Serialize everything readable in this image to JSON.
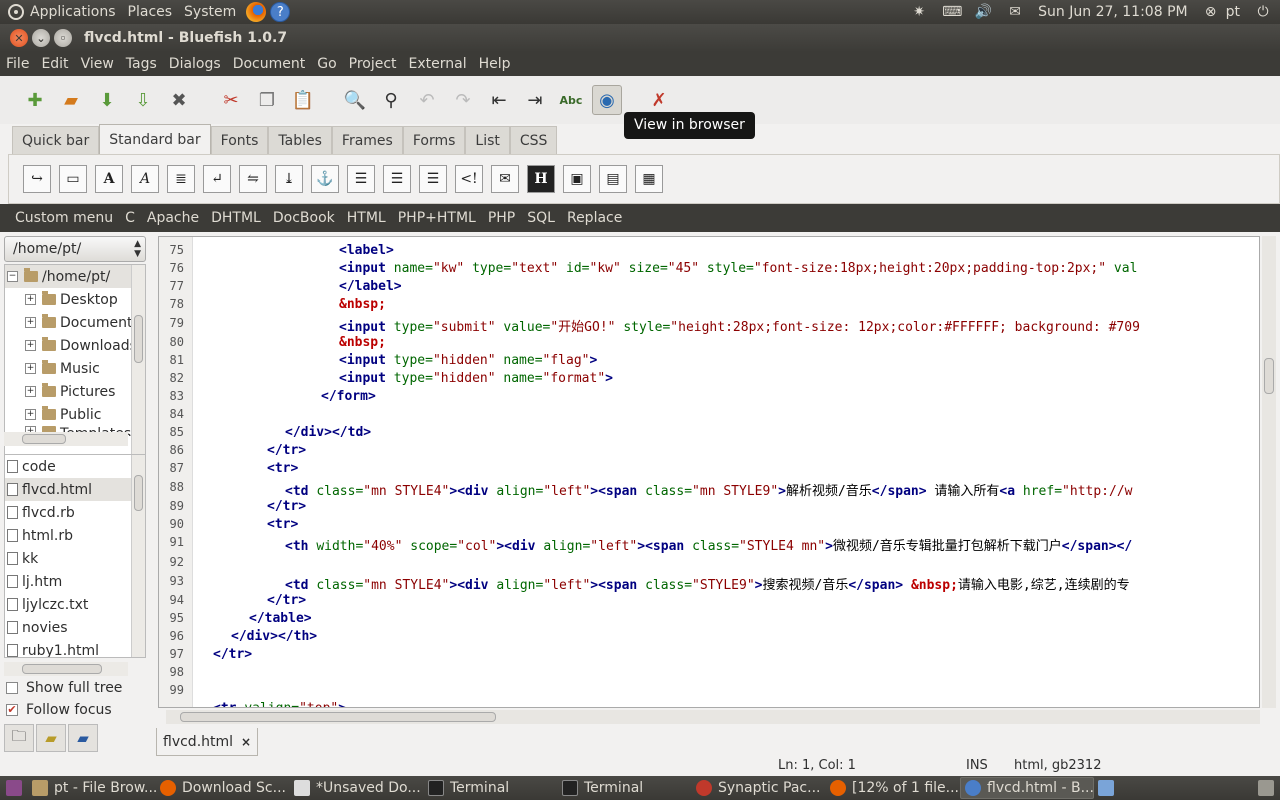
{
  "top_panel": {
    "menus": [
      "Applications",
      "Places",
      "System"
    ],
    "clock": "Sun Jun 27, 11:08 PM",
    "user": "pt"
  },
  "window": {
    "title": "flvcd.html - Bluefish 1.0.7"
  },
  "menubar": [
    "File",
    "Edit",
    "View",
    "Tags",
    "Dialogs",
    "Document",
    "Go",
    "Project",
    "External",
    "Help"
  ],
  "toolbar": {
    "tooltip": "View in browser"
  },
  "tabs": [
    "Quick bar",
    "Standard bar",
    "Fonts",
    "Tables",
    "Frames",
    "Forms",
    "List",
    "CSS"
  ],
  "custom_menu": [
    "Custom menu",
    "C",
    "Apache",
    "DHTML",
    "DocBook",
    "HTML",
    "PHP+HTML",
    "PHP",
    "SQL",
    "Replace"
  ],
  "left_pane": {
    "dir_combo": "/home/pt/",
    "tree": [
      "/home/pt/",
      "Desktop",
      "Documents",
      "Downloads",
      "Music",
      "Pictures",
      "Public",
      "Templates"
    ],
    "files": [
      "code",
      "flvcd.html",
      "flvcd.rb",
      "html.rb",
      "kk",
      "lj.htm",
      "ljylczc.txt",
      "novies",
      "ruby1.html"
    ],
    "show_full_tree": "Show full tree",
    "follow_focus": "Follow focus"
  },
  "editor": {
    "line_numbers": [
      "75",
      "76",
      "77",
      "78",
      "79",
      "80",
      "81",
      "82",
      "83",
      "84",
      "85",
      "86",
      "87",
      "88",
      "89",
      "90",
      "91",
      "92",
      "93",
      "94",
      "95",
      "96",
      "97",
      "98",
      "99"
    ],
    "doc_tab": "flvcd.html"
  },
  "statusbar": {
    "position": "Ln: 1, Col: 1",
    "mode": "INS",
    "encoding": "html, gb2312"
  },
  "taskbar": [
    "pt - File Brow...",
    "Download Sc...",
    "*Unsaved Do...",
    "Terminal",
    "Terminal",
    "Synaptic Pac...",
    "[12% of 1 file...",
    "flvcd.html - B..."
  ]
}
